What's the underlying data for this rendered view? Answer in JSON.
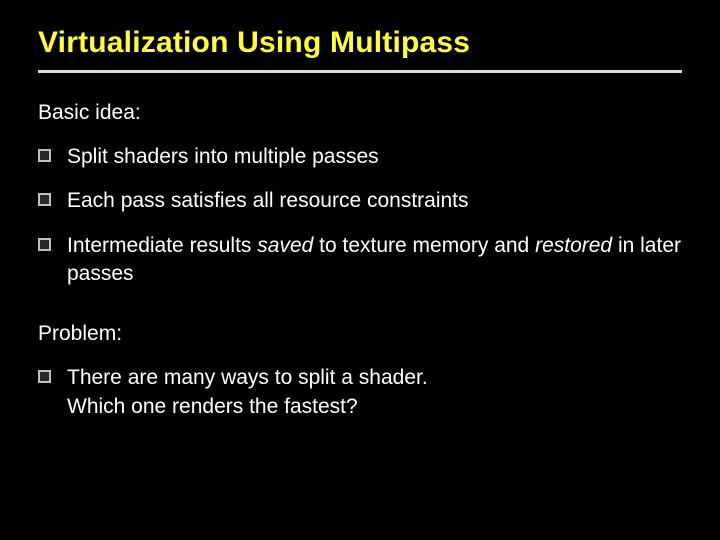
{
  "title": "Virtualization Using Multipass",
  "sections": [
    {
      "heading": "Basic idea:",
      "bullets": [
        {
          "html": "Split shaders into multiple passes"
        },
        {
          "html": "Each pass satisfies all resource constraints"
        },
        {
          "html": "Intermediate results <em>saved</em> to texture memory and <em>restored</em> in later passes"
        }
      ]
    },
    {
      "heading": "Problem:",
      "bullets": [
        {
          "html": "There are many ways to split a shader.<br>Which one renders the fastest?"
        }
      ]
    }
  ]
}
